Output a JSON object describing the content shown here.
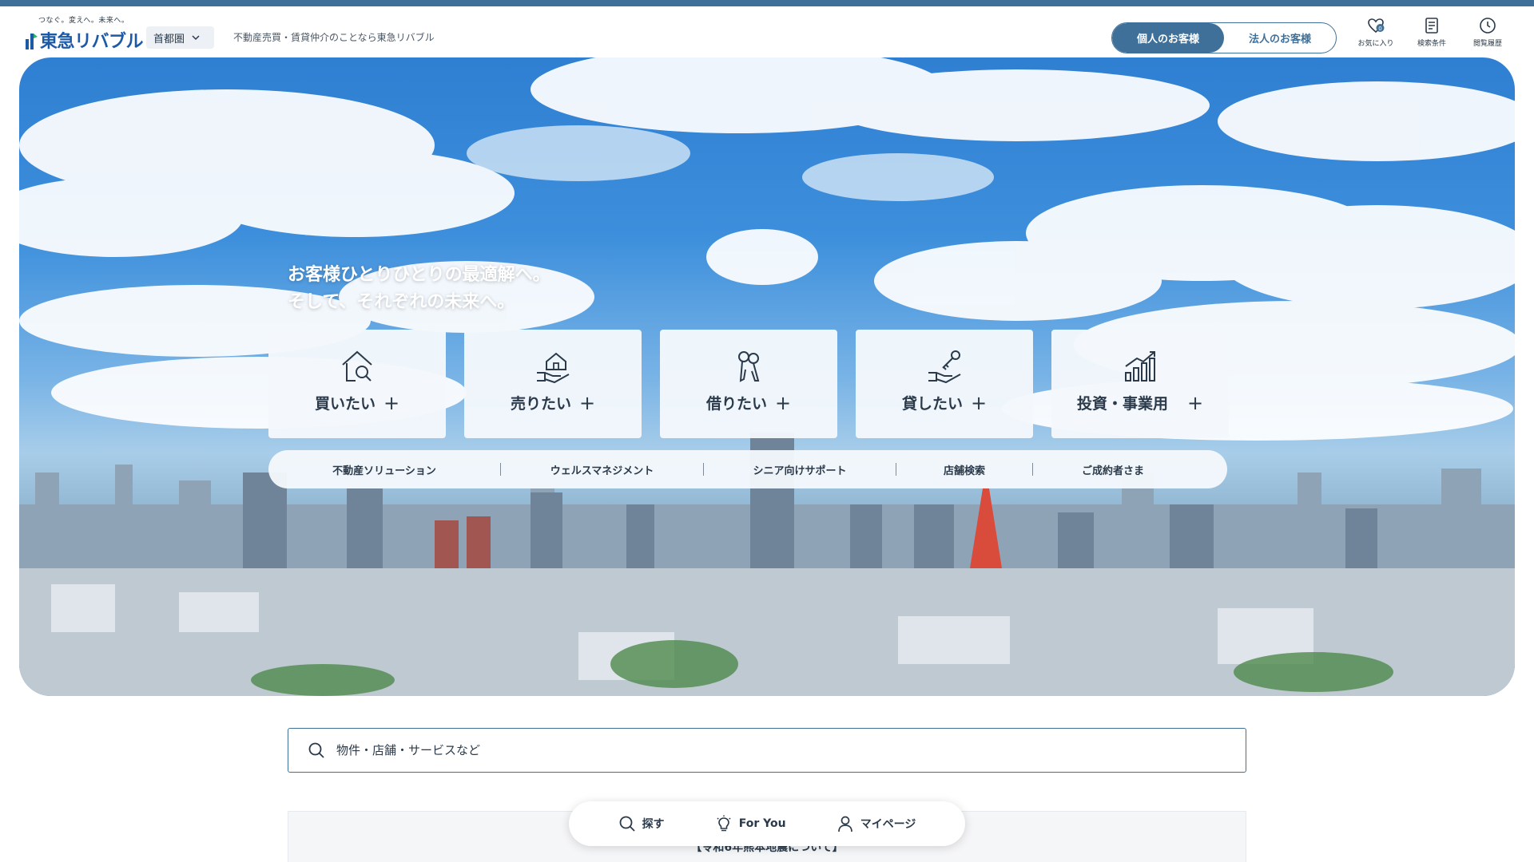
{
  "brand": {
    "tagline": "つなぐ。変えへ。未来へ。",
    "name": "東急リバブル"
  },
  "header": {
    "region": "首都圏",
    "tagline": "不動産売買・賃貸仲介のことなら東急リバブル",
    "toggle": {
      "personal": "個人のお客様",
      "corporate": "法人のお客様",
      "active": "personal"
    },
    "util": {
      "favorites_label": "お気に入り",
      "favorites_count": "0",
      "search_conditions_label": "検索条件",
      "history_label": "閲覧履歴"
    }
  },
  "hero": {
    "headline_line1": "お客様ひとりひとりの最適解へ。",
    "headline_line2": "そして、それぞれの未来へ。",
    "cards": [
      {
        "label": "買いたい",
        "icon": "house-search-icon"
      },
      {
        "label": "売りたい",
        "icon": "hand-house-icon"
      },
      {
        "label": "借りたい",
        "icon": "keys-icon"
      },
      {
        "label": "貸したい",
        "icon": "hand-key-icon"
      },
      {
        "label": "投資・事業用",
        "icon": "bar-chart-growth-icon"
      }
    ],
    "subnav": [
      "不動産ソリューション",
      "ウェルスマネジメント",
      "シニア向けサポート",
      "店舗検索",
      "ご成約者さま"
    ]
  },
  "search": {
    "placeholder": "物件・店舗・サービスなど"
  },
  "notice": {
    "text": "【令和6年熊本地震について】"
  },
  "bottom_nav": {
    "search": "探す",
    "for_you": "For You",
    "mypage": "マイページ"
  },
  "colors": {
    "accent": "#3f7099",
    "brand_blue": "#1d5aa6",
    "text": "#2b3a4a"
  }
}
